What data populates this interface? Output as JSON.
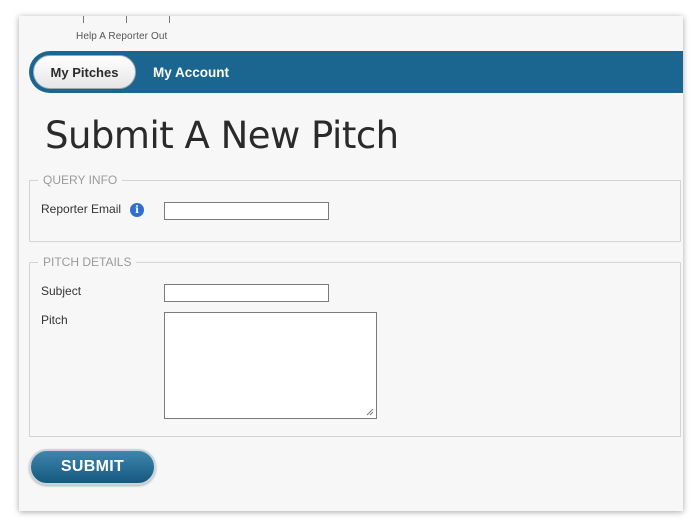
{
  "header": {
    "brand": "Help A Reporter Out"
  },
  "nav": {
    "tabs": [
      {
        "label": "My Pitches",
        "active": true
      },
      {
        "label": "My Account",
        "active": false
      }
    ],
    "color": "#1a6690"
  },
  "page": {
    "title": "Submit A New Pitch"
  },
  "query_info": {
    "legend": "QUERY INFO",
    "reporter_email_label": "Reporter Email",
    "reporter_email_value": "",
    "info_icon": "info-icon"
  },
  "pitch_details": {
    "legend": "PITCH DETAILS",
    "subject_label": "Subject",
    "subject_value": "",
    "pitch_label": "Pitch",
    "pitch_value": ""
  },
  "actions": {
    "submit_label": "SUBMIT"
  }
}
